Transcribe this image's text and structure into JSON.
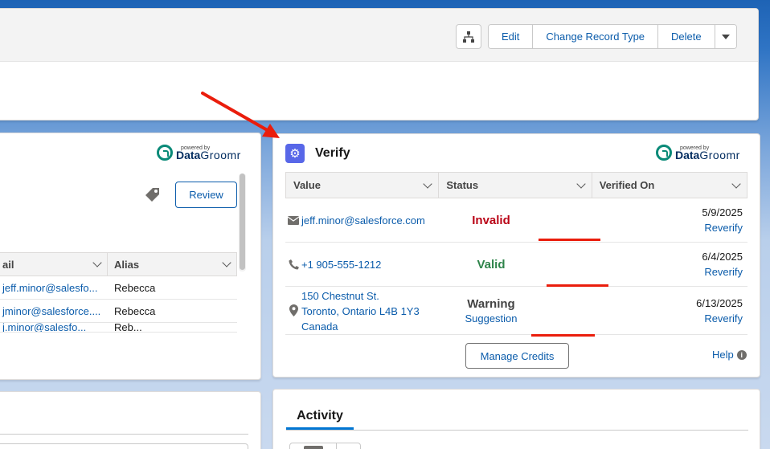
{
  "header": {
    "actions": {
      "edit_label": "Edit",
      "change_record_type_label": "Change Record Type",
      "delete_label": "Delete"
    }
  },
  "left_panel": {
    "logo": {
      "powered_by": "powered by",
      "brand_bold": "Data",
      "brand_light": "Groomr"
    },
    "review_label": "Review",
    "table": {
      "columns": [
        "ail",
        "Alias"
      ],
      "rows": [
        {
          "email": "jeff.minor@salesfo...",
          "alias": "Rebecca"
        },
        {
          "email": "jminor@salesforce....",
          "alias": "Rebecca"
        },
        {
          "email": "j.minor@salesfo...",
          "alias": "Reb..."
        }
      ]
    }
  },
  "verify": {
    "title": "Verify",
    "logo": {
      "powered_by": "powered by",
      "brand_bold": "Data",
      "brand_light": "Groomr"
    },
    "columns": [
      "Value",
      "Status",
      "Verified On"
    ],
    "rows": [
      {
        "icon": "email-icon",
        "value": "jeff.minor@salesforce.com",
        "status": "Invalid",
        "date": "5/9/2025",
        "action": "Reverify"
      },
      {
        "icon": "phone-icon",
        "value": "+1 905-555-1212",
        "status": "Valid",
        "date": "6/4/2025",
        "action": "Reverify"
      },
      {
        "icon": "location-pin-icon",
        "address": [
          "150 Chestnut St.",
          "Toronto, Ontario L4B 1Y3",
          "Canada"
        ],
        "status": "Warning",
        "status_link": "Suggestion",
        "date": "6/13/2025",
        "action": "Reverify"
      }
    ],
    "manage_credits_label": "Manage Credits",
    "help_label": "Help"
  },
  "activity": {
    "tab_label": "Activity"
  },
  "colors": {
    "link": "#0b5cab",
    "invalid": "#ba0517",
    "valid": "#2e844a",
    "annotation": "#ea1d0c",
    "verify_icon": "#5867e8"
  }
}
